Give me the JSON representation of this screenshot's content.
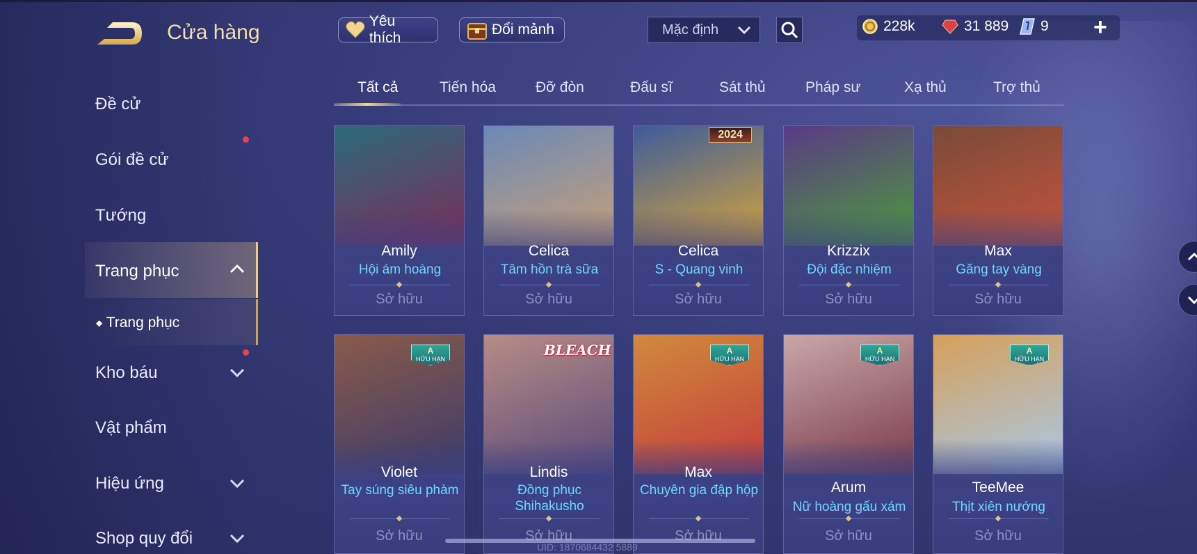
{
  "header": {
    "title": "Cửa hàng",
    "favorite_label": "Yêu thích",
    "exchange_label": "Đổi mảnh",
    "sort_value": "Mặc định",
    "currencies": {
      "gold": "228k",
      "ruby": "31 889",
      "voucher": "9"
    }
  },
  "sidebar": {
    "items": [
      {
        "label": "Đề cử"
      },
      {
        "label": "Gói đề cử"
      },
      {
        "label": "Tướng"
      },
      {
        "label": "Trang phục"
      },
      {
        "label": "Kho báu"
      },
      {
        "label": "Vật phẩm"
      },
      {
        "label": "Hiệu ứng"
      },
      {
        "label": "Shop quy đổi"
      }
    ],
    "sub_item": "Trang phục"
  },
  "tabs": [
    "Tất cả",
    "Tiến hóa",
    "Đỡ đòn",
    "Đấu sĩ",
    "Sát thủ",
    "Pháp sư",
    "Xạ thủ",
    "Trợ thủ"
  ],
  "cards": [
    {
      "hero": "Amily",
      "skin": "Hội ám hoàng",
      "status": "Sở hữu",
      "colors": [
        "#2c6a7a",
        "#7b2c5a"
      ]
    },
    {
      "hero": "Celica",
      "skin": "Tâm hồn trà sữa",
      "status": "Sở hữu",
      "colors": [
        "#6a88b8",
        "#c8a178"
      ]
    },
    {
      "hero": "Celica",
      "skin": "S - Quang vinh",
      "status": "Sở hữu",
      "tag": "2024",
      "colors": [
        "#3d5c9a",
        "#d6a43c"
      ]
    },
    {
      "hero": "Krizzix",
      "skin": "Đội đặc nhiệm",
      "status": "Sở hữu",
      "colors": [
        "#5a3a86",
        "#4d9a3c"
      ]
    },
    {
      "hero": "Max",
      "skin": "Găng tay vàng",
      "status": "Sở hữu",
      "colors": [
        "#7a4a3a",
        "#c3543c"
      ]
    },
    {
      "hero": "Violet",
      "skin": "Tay súng siêu phàm",
      "status": "Sở hữu",
      "badge": "A",
      "badge_text": "HỮU HẠN",
      "colors": [
        "#8a5a4a",
        "#3c3b6a"
      ]
    },
    {
      "hero": "Lindis",
      "skin": "Đồng phục Shihakusho",
      "status": "Sở hữu",
      "logo": "BLEACH",
      "colors": [
        "#b68c86",
        "#5c4a7a"
      ]
    },
    {
      "hero": "Max",
      "skin": "Chuyên gia đập hộp",
      "status": "Sở hữu",
      "badge": "A",
      "badge_text": "HỮU HẠN",
      "colors": [
        "#d08a3c",
        "#c43c3c"
      ]
    },
    {
      "hero": "Arum",
      "skin": "Nữ hoàng gấu xám",
      "status": "Sở hữu",
      "badge": "A",
      "badge_text": "HỮU HẠN",
      "colors": [
        "#c8a8a8",
        "#7a3a4a"
      ]
    },
    {
      "hero": "TeeMee",
      "skin": "Thịt xiên nướng",
      "status": "Sở hữu",
      "badge": "A",
      "badge_text": "HỮU HẠN",
      "colors": [
        "#d6a05a",
        "#a8c8e8"
      ]
    }
  ],
  "footer": {
    "uid": "UID: 1870684432 5889"
  },
  "icons": {
    "back": "back-arrow-icon",
    "heart": "heart-icon",
    "chest": "treasure-chest-icon",
    "search": "search-icon",
    "gold": "gold-coin-icon",
    "ruby": "ruby-gem-icon",
    "voucher": "voucher-icon",
    "plus": "plus-icon"
  }
}
